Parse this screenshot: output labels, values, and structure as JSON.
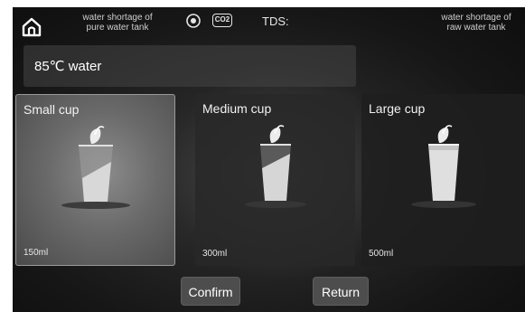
{
  "status_bar": {
    "home_icon": "home-icon",
    "pure_tank_message": "water shortage of\npure water tank",
    "sensor_icon": "target-icon",
    "co2_label": "CO2",
    "tds_label": "TDS:",
    "raw_tank_message": "water shortage of\nraw water tank"
  },
  "mode": {
    "label": "85℃ water"
  },
  "cups": [
    {
      "label": "Small cup",
      "volume": "150ml",
      "selected": true
    },
    {
      "label": "Medium cup",
      "volume": "300ml",
      "selected": false
    },
    {
      "label": "Large cup",
      "volume": "500ml",
      "selected": false
    }
  ],
  "actions": {
    "confirm_label": "Confirm",
    "return_label": "Return"
  },
  "colors": {
    "background": "#161616",
    "selected_card": "#6a6a6a",
    "button": "#4d4d4d",
    "text": "#ffffff"
  }
}
